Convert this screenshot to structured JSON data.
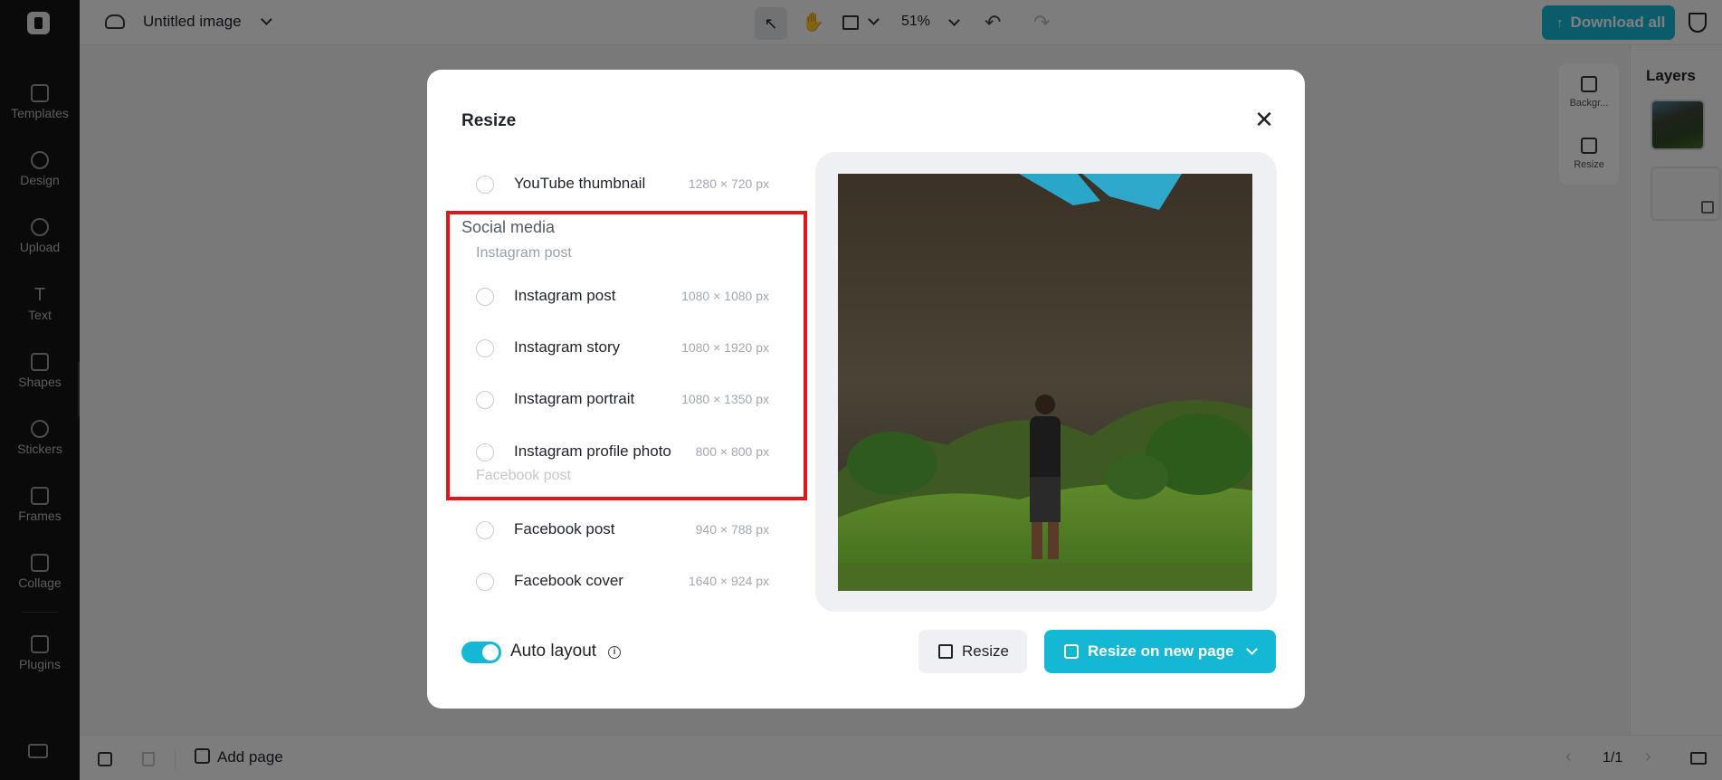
{
  "app": {
    "document_title": "Untitled image",
    "zoom_level": "51%",
    "download_label": "Download all",
    "accent_color": "#14b8d4"
  },
  "sidebar": {
    "items": [
      {
        "label": "Templates",
        "icon": "templates-icon"
      },
      {
        "label": "Design",
        "icon": "design-icon"
      },
      {
        "label": "Upload",
        "icon": "upload-icon"
      },
      {
        "label": "Text",
        "icon": "text-icon"
      },
      {
        "label": "Shapes",
        "icon": "shapes-icon"
      },
      {
        "label": "Stickers",
        "icon": "stickers-icon"
      },
      {
        "label": "Frames",
        "icon": "frames-icon"
      },
      {
        "label": "Collage",
        "icon": "collage-icon"
      },
      {
        "label": "Plugins",
        "icon": "plugins-icon"
      }
    ]
  },
  "float_panel": {
    "background_label": "Backgr...",
    "resize_label": "Resize"
  },
  "layers": {
    "title": "Layers"
  },
  "bottombar": {
    "add_page_label": "Add page",
    "page_count": "1/1"
  },
  "modal": {
    "title": "Resize",
    "options_top": [
      {
        "label": "YouTube thumbnail",
        "size": "1280 × 720 px"
      }
    ],
    "social_section": "Social media",
    "instagram_group": "Instagram post",
    "instagram_options": [
      {
        "label": "Instagram post",
        "size": "1080 × 1080 px"
      },
      {
        "label": "Instagram story",
        "size": "1080 × 1920 px"
      },
      {
        "label": "Instagram portrait",
        "size": "1080 × 1350 px"
      },
      {
        "label": "Instagram profile photo",
        "size": "800 × 800 px"
      }
    ],
    "facebook_group": "Facebook post",
    "facebook_options": [
      {
        "label": "Facebook post",
        "size": "940 × 788 px"
      },
      {
        "label": "Facebook cover",
        "size": "1640 × 924 px"
      }
    ],
    "auto_layout_label": "Auto layout",
    "auto_layout_on": true,
    "resize_button": "Resize",
    "resize_new_button": "Resize on new page",
    "highlight_color": "#e0161c"
  }
}
